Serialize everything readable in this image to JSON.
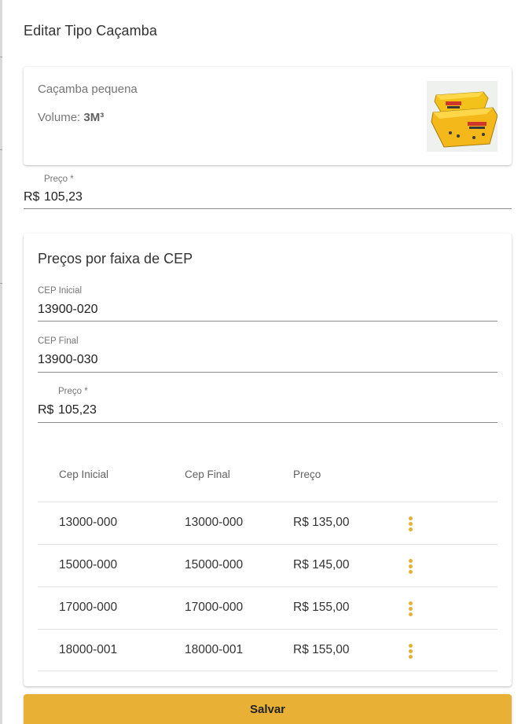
{
  "dialog": {
    "title": "Editar Tipo Caçamba"
  },
  "product": {
    "name": "Caçamba pequena",
    "volume_label": "Volume:",
    "volume_value": "3M³",
    "image_icon": "cacamba-photo"
  },
  "price_field": {
    "label": "Preço *",
    "prefix": "R$",
    "value": "105,23"
  },
  "cep_section": {
    "title": "Preços por faixa de CEP",
    "cep_inicial": {
      "label": "CEP Inicial",
      "value": "13900-020"
    },
    "cep_final": {
      "label": "CEP Final",
      "value": "13900-030"
    },
    "preco": {
      "label": "Preço *",
      "prefix": "R$",
      "value": "105,23"
    },
    "table": {
      "headers": [
        "Cep Inicial",
        "Cep Final",
        "Preço"
      ],
      "rows": [
        {
          "cep_inicial": "13000-000",
          "cep_final": "13000-000",
          "preco": "R$ 135,00"
        },
        {
          "cep_inicial": "15000-000",
          "cep_final": "15000-000",
          "preco": "R$ 145,00"
        },
        {
          "cep_inicial": "17000-000",
          "cep_final": "17000-000",
          "preco": "R$ 155,00"
        },
        {
          "cep_inicial": "18000-001",
          "cep_final": "18000-001",
          "preco": "R$ 155,00"
        }
      ],
      "row_menu_icon": "more-vertical-icon"
    }
  },
  "actions": {
    "save_label": "Salvar"
  },
  "colors": {
    "accent": "#e8b136",
    "menu_dots": "#e7b034",
    "text_primary": "#212121",
    "text_secondary": "#757575"
  }
}
